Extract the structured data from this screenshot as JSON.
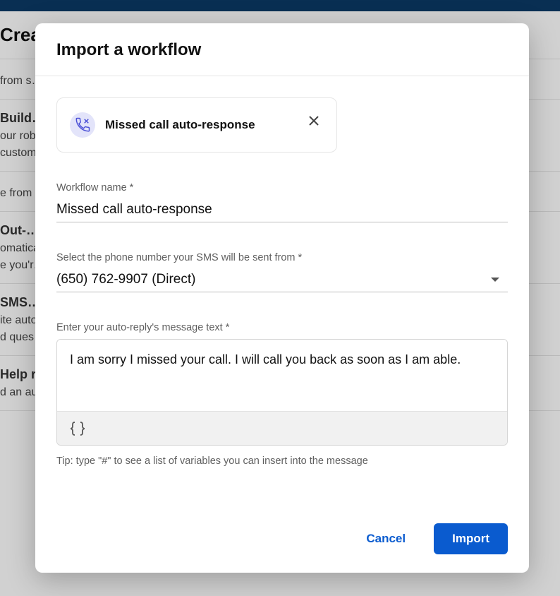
{
  "background": {
    "header": "Create",
    "section_from": "from s…",
    "row1_title": "Build…",
    "row1_desc1": "our rob…",
    "row1_desc2": "custom…",
    "section_from2": "e from …",
    "row2_title": "Out-…",
    "row2_desc1": "omatica…",
    "row2_desc2": "e you'r…",
    "row3_title": "SMS…",
    "row3_desc1": "ite auto…",
    "row3_desc2": "d ques…",
    "row4_title": "Help request auto-response",
    "row4_desc": "d an automated response when someone"
  },
  "modal": {
    "title": "Import a workflow",
    "workflow_card": {
      "name": "Missed call auto-response"
    },
    "fields": {
      "name_label": "Workflow name *",
      "name_value": "Missed call auto-response",
      "phone_label": "Select the phone number your SMS will be sent from *",
      "phone_value": "(650) 762-9907 (Direct)",
      "message_label": "Enter your auto-reply's message text *",
      "message_value": "I am sorry I missed your call. I will call you back as soon as I am able.",
      "tip": "Tip: type \"#\" to see a list of variables you can insert into the message"
    },
    "buttons": {
      "cancel": "Cancel",
      "import": "Import"
    }
  }
}
